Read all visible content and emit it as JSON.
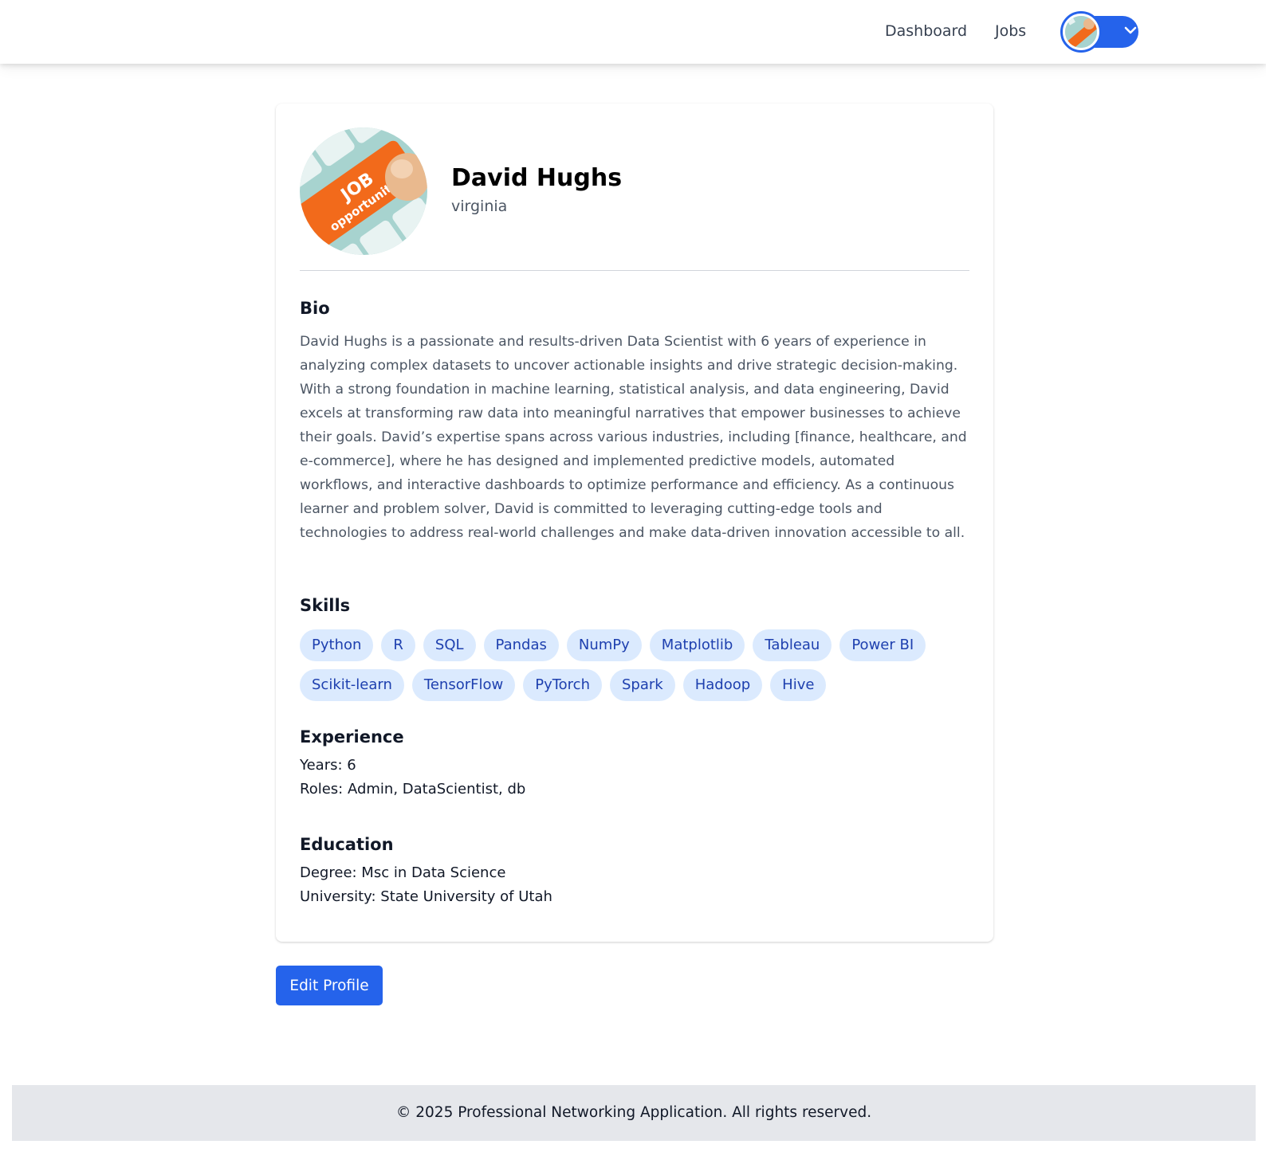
{
  "header": {
    "nav": [
      {
        "label": "Dashboard"
      },
      {
        "label": "Jobs"
      }
    ],
    "user_menu": {
      "avatar_icon": "user-avatar-icon",
      "dropdown_icon": "chevron-down-icon"
    }
  },
  "profile": {
    "image_icon": "job-opportunities-image",
    "image_lettering": [
      "JOB",
      "opportunities"
    ],
    "name": "David Hughs",
    "location": "virginia",
    "bio_title": "Bio",
    "bio": "David Hughs is a passionate and results-driven Data Scientist with 6 years of experience in analyzing complex datasets to uncover actionable insights and drive strategic decision-making. With a strong foundation in machine learning, statistical analysis, and data engineering, David excels at transforming raw data into meaningful narratives that empower businesses to achieve their goals. David’s expertise spans across various industries, including [finance, healthcare, and e-commerce], where he has designed and implemented predictive models, automated workflows, and interactive dashboards to optimize performance and efficiency. As a continuous learner and problem solver, David is committed to leveraging cutting-edge tools and technologies to address real-world challenges and make data-driven innovation accessible to all.",
    "skills_title": "Skills",
    "skills": [
      "Python",
      "R",
      "SQL",
      "Pandas",
      "NumPy",
      "Matplotlib",
      "Tableau",
      "Power BI",
      "Scikit-learn",
      "TensorFlow",
      "PyTorch",
      "Spark",
      "Hadoop",
      "Hive"
    ],
    "experience_title": "Experience",
    "experience": {
      "years": "Years: 6",
      "roles": "Roles: Admin, DataScientist, db"
    },
    "education_title": "Education",
    "education": {
      "degree": "Degree: Msc in Data Science",
      "university": "University: State University of Utah"
    }
  },
  "actions": {
    "edit_label": "Edit Profile"
  },
  "footer": {
    "text": "© 2025 Professional Networking Application. All rights reserved."
  },
  "colors": {
    "primary": "#2563eb",
    "chip_bg": "#dbeafe",
    "chip_text": "#1e40af",
    "footer_bg": "#e5e7eb",
    "image_orange": "#f26a1b",
    "image_teal": "#a7d3cf"
  }
}
